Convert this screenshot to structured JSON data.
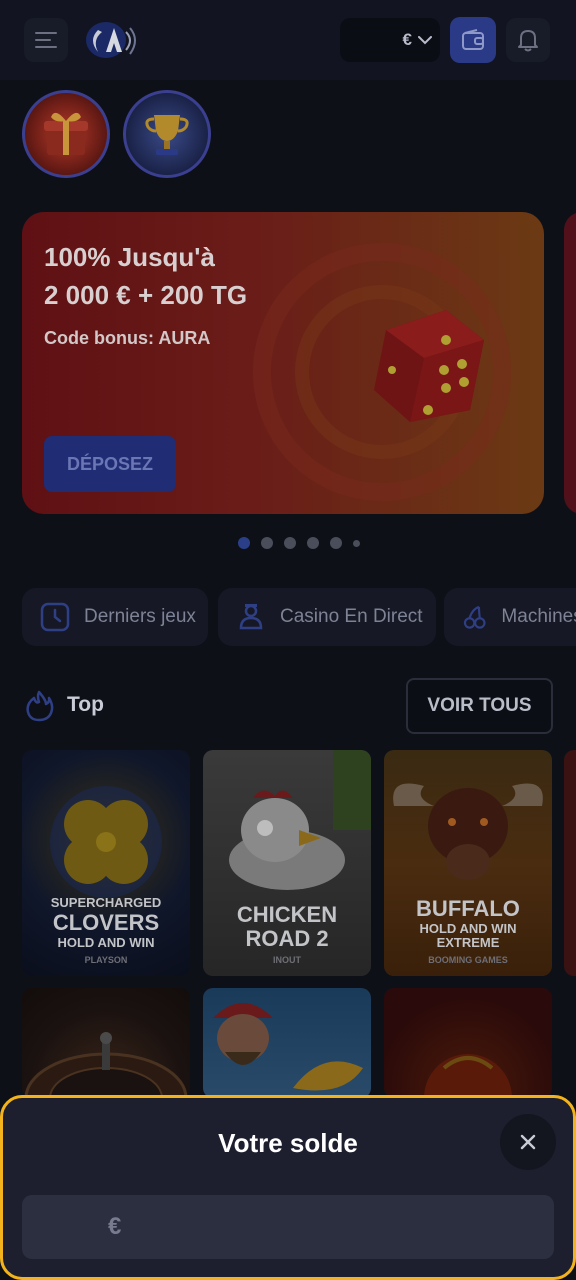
{
  "header": {
    "currency_symbol": "€",
    "icons": [
      "menu-icon",
      "logo",
      "chevron-down-icon",
      "wallet-icon",
      "bell-icon"
    ]
  },
  "stories": [
    {
      "icon": "gift-icon"
    },
    {
      "icon": "trophy-icon"
    }
  ],
  "banner": {
    "title": "100% Jusqu'à\n2 000 € + 200 TG",
    "code": "Code bonus: AURA",
    "cta": "DÉPOSEZ",
    "slides": 6,
    "active_slide": 1
  },
  "categories": [
    {
      "label": "Derniers jeux",
      "icon": "clock-icon"
    },
    {
      "label": "Casino En Direct",
      "icon": "dealer-icon"
    },
    {
      "label": "Machines à sous",
      "icon": "cherry-icon"
    }
  ],
  "top_section": {
    "title": "Top",
    "see_all": "VOIR TOUS"
  },
  "games_row1": [
    {
      "line1": "SUPERCHARGED",
      "line2": "CLOVERS",
      "line3": "HOLD AND WIN",
      "provider": "PLAYSON"
    },
    {
      "line1": "CHICKEN",
      "line2": "ROAD 2",
      "provider": "INOUT"
    },
    {
      "line1": "BUFFALO",
      "line2": "HOLD AND WIN",
      "line3": "EXTREME",
      "provider": "BOOMING GAMES"
    }
  ],
  "balance_sheet": {
    "title": "Votre solde",
    "currency": "€",
    "close_icon": "close-icon"
  },
  "colors": {
    "accent": "#f2b31c",
    "primary": "#2b3a86",
    "background": "#0e1018"
  }
}
